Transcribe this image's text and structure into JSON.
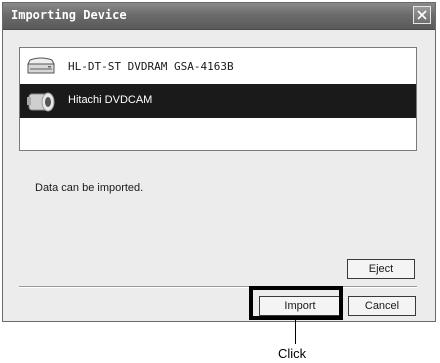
{
  "window": {
    "title": "Importing Device",
    "close_icon": "close-icon"
  },
  "device_list": {
    "items": [
      {
        "label": "HL-DT-ST DVDRAM GSA-4163B",
        "icon": "dvd-drive-icon",
        "selected": false
      },
      {
        "label": "Hitachi DVDCAM",
        "icon": "camcorder-icon",
        "selected": true
      }
    ]
  },
  "status": {
    "message": "Data can be imported."
  },
  "buttons": {
    "eject": "Eject",
    "import": "Import",
    "cancel": "Cancel"
  },
  "annotation": {
    "label": "Click"
  },
  "colors": {
    "titlebar": "#6b6b6b",
    "selection": "#1a1a1a",
    "dialog_bg": "#ececec"
  }
}
